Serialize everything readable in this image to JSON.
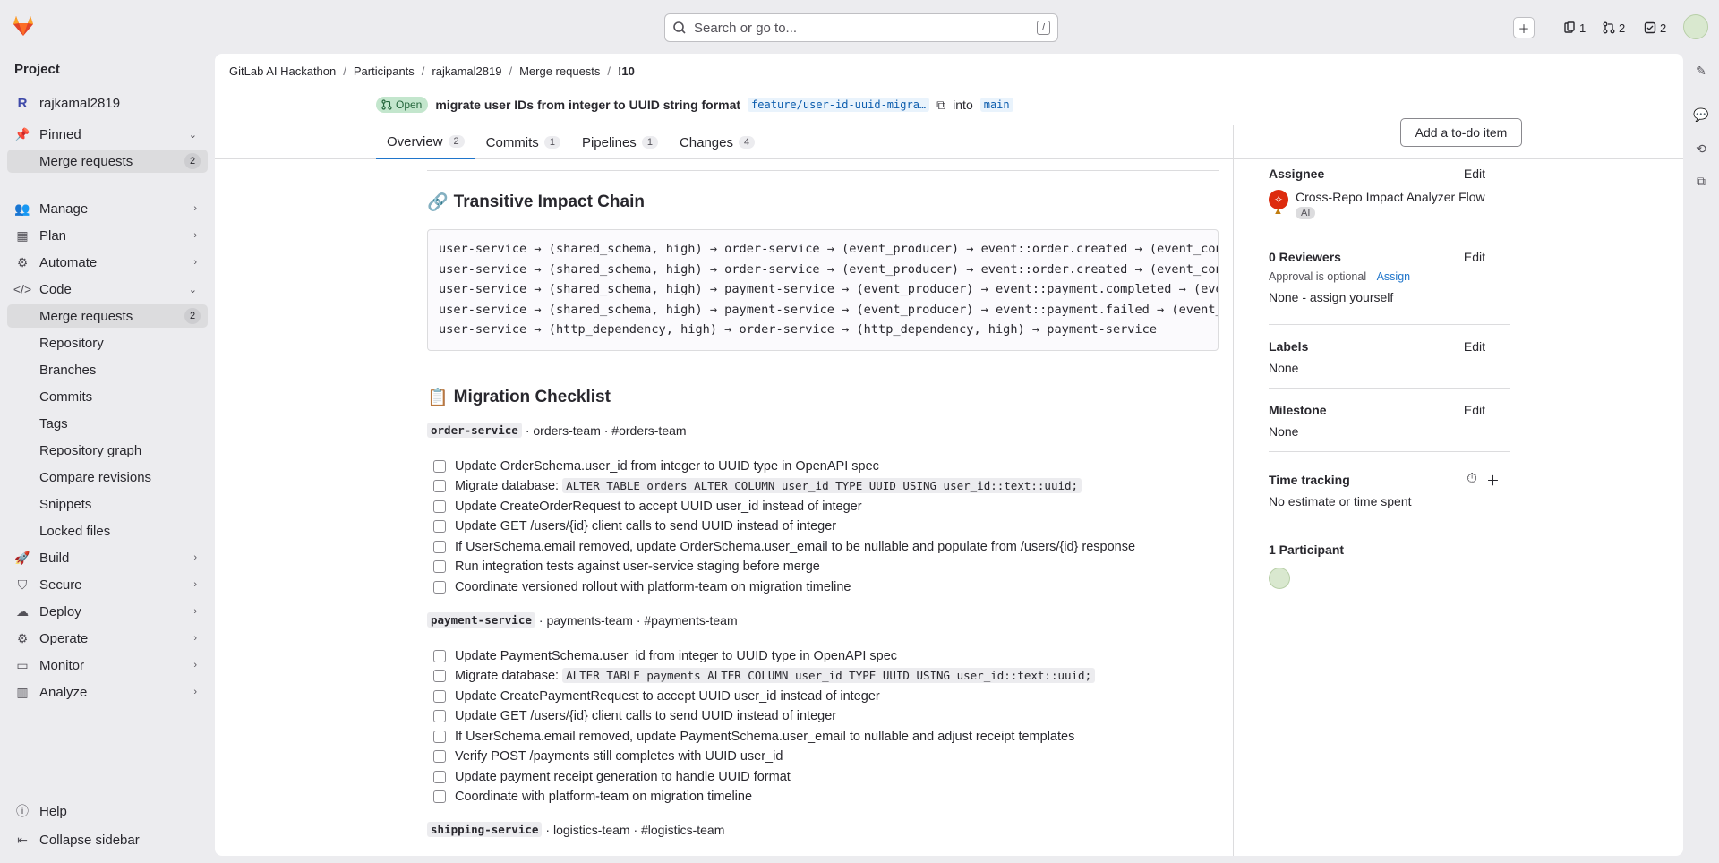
{
  "topbar": {
    "search_placeholder": "Search or go to...",
    "search_shortcut": "/",
    "issues_count": "1",
    "mrs_count": "2",
    "todos_count": "2"
  },
  "sidebar": {
    "title": "Project",
    "project_name": "rajkamal2819",
    "project_initial": "R",
    "pinned": "Pinned",
    "pinned_mr": "Merge requests",
    "pinned_mr_count": "2",
    "items": [
      "Manage",
      "Plan",
      "Automate",
      "Code"
    ],
    "code_sub": [
      "Merge requests",
      "Repository",
      "Branches",
      "Commits",
      "Tags",
      "Repository graph",
      "Compare revisions",
      "Snippets",
      "Locked files"
    ],
    "code_mr_count": "2",
    "items2": [
      "Build",
      "Secure",
      "Deploy",
      "Operate",
      "Monitor",
      "Analyze"
    ],
    "help": "Help",
    "collapse": "Collapse sidebar"
  },
  "breadcrumb": [
    "GitLab AI Hackathon",
    "Participants",
    "rajkamal2819",
    "Merge requests",
    "!10"
  ],
  "mr": {
    "status": "Open",
    "title": "migrate user IDs from integer to UUID string format",
    "source_branch": "feature/user-id-uuid-migra…",
    "into": "into",
    "target_branch": "main",
    "tabs": [
      {
        "label": "Overview",
        "count": "2"
      },
      {
        "label": "Commits",
        "count": "1"
      },
      {
        "label": "Pipelines",
        "count": "1"
      },
      {
        "label": "Changes",
        "count": "4"
      }
    ],
    "todo_button": "Add a to-do item"
  },
  "content": {
    "chain_heading": "Transitive Impact Chain",
    "chain_lines": [
      "user-service → (shared_schema, high) → order-service → (event_producer) → event::order.created → (event_consumer) → notification-service",
      "user-service → (shared_schema, high) → order-service → (event_producer) → event::order.created → (event_consumer) → shipping-service",
      "user-service → (shared_schema, high) → payment-service → (event_producer) → event::payment.completed → (event_consumer) → order-service",
      "user-service → (shared_schema, high) → payment-service → (event_producer) → event::payment.failed → (event_consumer) → notification-service",
      "user-service → (http_dependency, high) → order-service → (http_dependency, high) → payment-service"
    ],
    "checklist_heading": "Migration Checklist",
    "services": [
      {
        "name": "order-service",
        "team": " · orders-team · #orders-team",
        "tasks": [
          {
            "text": "Update OrderSchema.user_id from integer to UUID type in OpenAPI spec"
          },
          {
            "text": "Migrate database: ",
            "code": "ALTER TABLE orders ALTER COLUMN user_id TYPE UUID USING user_id::text::uuid;"
          },
          {
            "text": "Update CreateOrderRequest to accept UUID user_id instead of integer"
          },
          {
            "text": "Update GET /users/{id} client calls to send UUID instead of integer"
          },
          {
            "text": "If UserSchema.email removed, update OrderSchema.user_email to be nullable and populate from /users/{id} response"
          },
          {
            "text": "Run integration tests against user-service staging before merge"
          },
          {
            "text": "Coordinate versioned rollout with platform-team on migration timeline"
          }
        ]
      },
      {
        "name": "payment-service",
        "team": " · payments-team · #payments-team",
        "tasks": [
          {
            "text": "Update PaymentSchema.user_id from integer to UUID type in OpenAPI spec"
          },
          {
            "text": "Migrate database: ",
            "code": "ALTER TABLE payments ALTER COLUMN user_id TYPE UUID USING user_id::text::uuid;"
          },
          {
            "text": "Update CreatePaymentRequest to accept UUID user_id instead of integer"
          },
          {
            "text": "Update GET /users/{id} client calls to send UUID instead of integer"
          },
          {
            "text": "If UserSchema.email removed, update PaymentSchema.user_email to nullable and adjust receipt templates"
          },
          {
            "text": "Verify POST /payments still completes with UUID user_id"
          },
          {
            "text": "Update payment receipt generation to handle UUID format"
          },
          {
            "text": "Coordinate with platform-team on migration timeline"
          }
        ]
      },
      {
        "name": "shipping-service",
        "team": " · logistics-team · #logistics-team",
        "tasks": []
      }
    ]
  },
  "right": {
    "assignee_title": "Assignee",
    "edit": "Edit",
    "assignee_name": "Cross-Repo Impact Analyzer Flow",
    "ai_badge": "AI",
    "reviewers_title": "0 Reviewers",
    "approval": "Approval is optional",
    "assign": "Assign",
    "reviewers_none": "None - assign yourself",
    "labels_title": "Labels",
    "labels_val": "None",
    "milestone_title": "Milestone",
    "milestone_val": "None",
    "time_title": "Time tracking",
    "time_val": "No estimate or time spent",
    "participants_title": "1 Participant"
  },
  "colors": {
    "accent": "#1f75cb",
    "open_badge_bg": "#c3e6cd",
    "assignee_icon": "#dd2b0e"
  }
}
